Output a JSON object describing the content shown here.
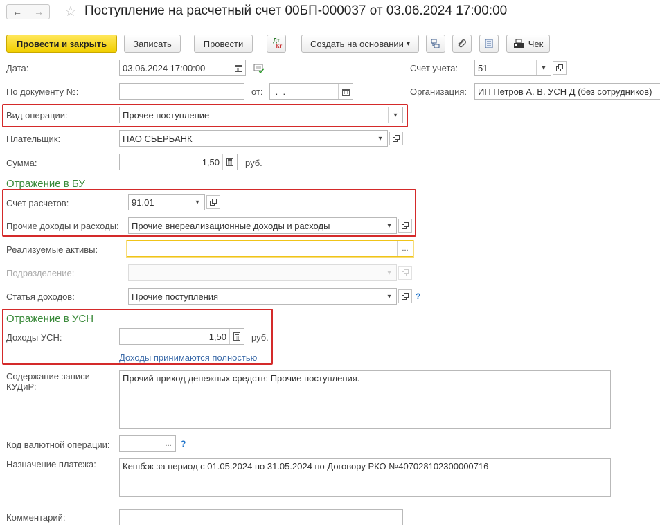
{
  "window": {
    "title": "Поступление на расчетный счет 00БП-000037 от 03.06.2024 17:00:00"
  },
  "nav": {
    "back_icon": "←",
    "forward_icon": "→",
    "star_icon": "☆"
  },
  "toolbar": {
    "post_close": "Провести и закрыть",
    "save": "Записать",
    "post": "Провести",
    "dtkt_top": "Дт",
    "dtkt_bottom": "Кт",
    "create_based": "Создать на основании",
    "create_based_caret": "▾",
    "check": "Чек"
  },
  "fields": {
    "date_label": "Дата:",
    "date_value": "03.06.2024 17:00:00",
    "account_label": "Счет учета:",
    "account_value": "51",
    "doc_label": "По документу №:",
    "doc_value": "",
    "from_label": "от:",
    "from_value": " .  .",
    "org_label": "Организация:",
    "org_value": "ИП Петров А. В. УСН Д (без сотрудников)",
    "op_label": "Вид операции:",
    "op_value": "Прочее поступление",
    "payer_label": "Плательщик:",
    "payer_value": "ПАО СБЕРБАНК",
    "sum_label": "Сумма:",
    "sum_value": "1,50",
    "sum_unit": "руб."
  },
  "bu": {
    "heading": "Отражение в БУ",
    "settle_label": "Счет расчетов:",
    "settle_value": "91.01",
    "income_label": "Прочие доходы и расходы:",
    "income_value": "Прочие внереализационные доходы и расходы",
    "assets_label": "Реализуемые активы:",
    "assets_value": "",
    "assets_btn": "...",
    "dept_label": "Подразделение:",
    "dept_value": "",
    "article_label": "Статья доходов:",
    "article_value": "Прочие поступления",
    "help": "?"
  },
  "usn": {
    "heading": "Отражение в УСН",
    "income_label": "Доходы УСН:",
    "income_value": "1,50",
    "income_unit": "руб.",
    "note_link": "Доходы принимаются полностью"
  },
  "kudir": {
    "label": "Содержание записи КУДиР:",
    "value": "Прочий приход денежных средств: Прочие поступления."
  },
  "currency_op": {
    "label": "Код валютной операции:",
    "value": "",
    "btn": "...",
    "help": "?"
  },
  "purpose": {
    "label": "Назначение платежа:",
    "value": "Кешбэк за период с 01.05.2024 по 31.05.2024 по Договору РКО №407028102300000716"
  },
  "comment": {
    "label": "Комментарий:",
    "value": ""
  },
  "colors": {
    "primary_button": "#f1cf00",
    "highlight_border": "#d42a2a",
    "section_heading": "#3a8a3a",
    "link": "#3b6aa8"
  }
}
